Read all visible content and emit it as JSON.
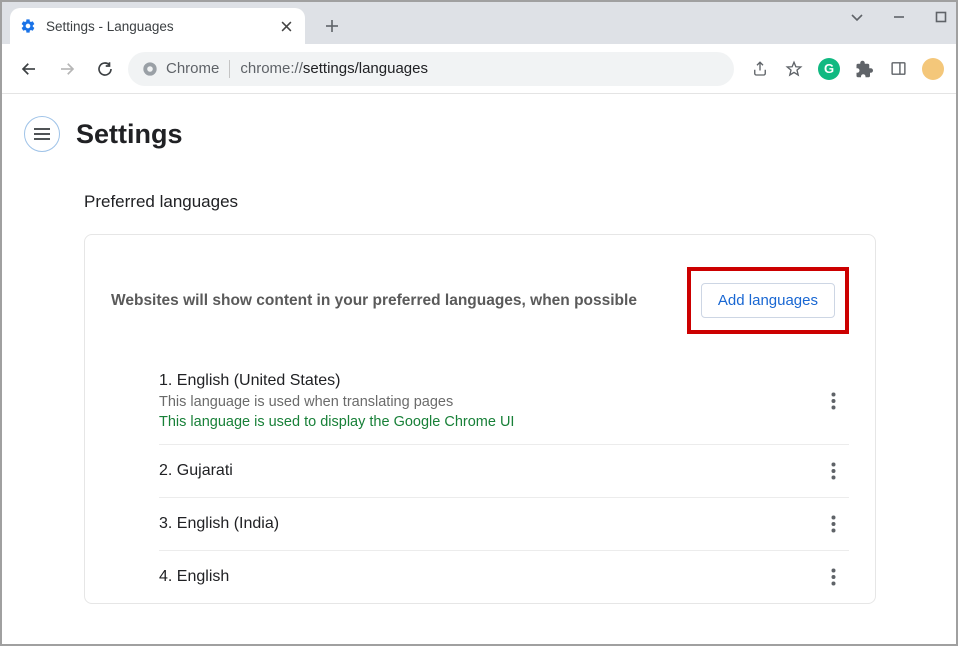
{
  "tab": {
    "title": "Settings - Languages"
  },
  "omnibox": {
    "chip": "Chrome",
    "url_prefix": "chrome://",
    "url_path": "settings/languages"
  },
  "page": {
    "title": "Settings",
    "section_label": "Preferred languages",
    "subtitle": "Websites will show content in your preferred languages, when possible",
    "add_button": "Add languages"
  },
  "languages": [
    {
      "name": "1. English (United States)",
      "sub1": "This language is used when translating pages",
      "sub2": "This language is used to display the Google Chrome UI"
    },
    {
      "name": "2. Gujarati"
    },
    {
      "name": "3. English (India)"
    },
    {
      "name": "4. English"
    }
  ]
}
